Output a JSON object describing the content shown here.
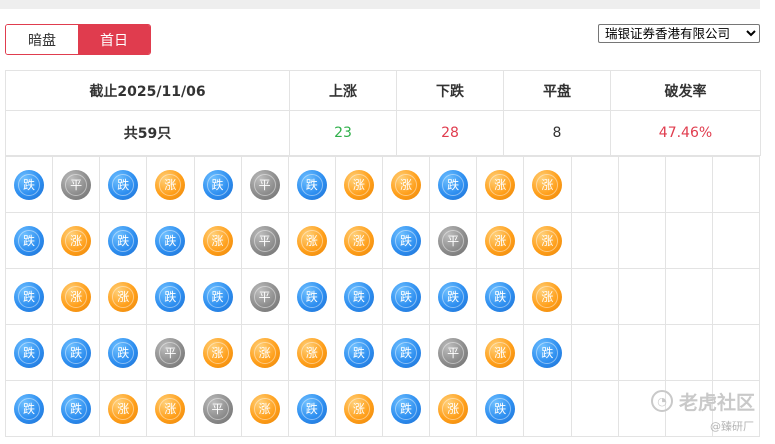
{
  "tabs": [
    {
      "label": "暗盘",
      "active": false
    },
    {
      "label": "首日",
      "active": true
    }
  ],
  "broker_select": {
    "selected": "瑞银证券香港有限公司"
  },
  "summary": {
    "date_header": "截止2025/11/06",
    "up_header": "上涨",
    "down_header": "下跌",
    "flat_header": "平盘",
    "rate_header": "破发率",
    "total": "共59只",
    "up_count": "23",
    "down_count": "28",
    "flat_count": "8",
    "break_rate": "47.46%"
  },
  "ball_labels": {
    "up": "涨",
    "down": "跌",
    "flat": "平"
  },
  "colors": {
    "accent": "#e03c4e",
    "up": "#ff9f1a",
    "down": "#2d8ef0",
    "flat": "#8c8c8c",
    "up_text": "#2fb04a",
    "down_text": "#e03c4e"
  },
  "grid_rows": [
    [
      "down",
      "flat",
      "down",
      "up",
      "down",
      "flat",
      "down",
      "up",
      "up",
      "down",
      "up",
      "up"
    ],
    [
      "down",
      "up",
      "down",
      "down",
      "up",
      "flat",
      "up",
      "up",
      "down",
      "flat",
      "up",
      "up"
    ],
    [
      "down",
      "up",
      "up",
      "down",
      "down",
      "flat",
      "down",
      "down",
      "down",
      "down",
      "down",
      "up"
    ],
    [
      "down",
      "down",
      "down",
      "flat",
      "up",
      "up",
      "up",
      "down",
      "down",
      "flat",
      "up",
      "down"
    ],
    [
      "down",
      "down",
      "up",
      "up",
      "flat",
      "up",
      "down",
      "up",
      "down",
      "up",
      "down"
    ]
  ],
  "watermark": {
    "text": "老虎社区",
    "credit": "@臻研厂"
  }
}
